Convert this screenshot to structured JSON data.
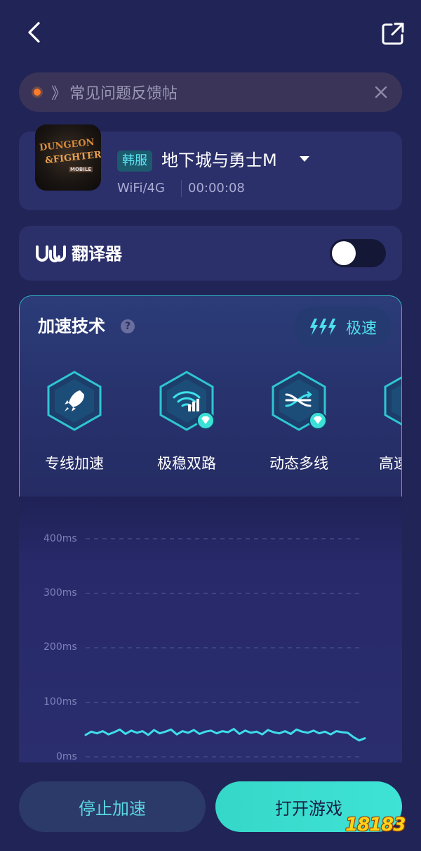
{
  "notice": {
    "arrow": "》",
    "text": "常见问题反馈帖"
  },
  "game": {
    "logo_line1": "DUNGEON",
    "logo_line2": "&FIGHTER",
    "logo_line3": "MOBILE",
    "region": "韩服",
    "title": "地下城与勇士M",
    "network": "WiFi/4G",
    "timer": "00:00:08"
  },
  "translator": {
    "label": "翻译器",
    "enabled": false
  },
  "tech": {
    "title": "加速技术",
    "help": "?",
    "speed_label": "极速",
    "features": [
      {
        "name": "专线加速",
        "icon": "rocket-icon",
        "premium": false
      },
      {
        "name": "极稳双路",
        "icon": "wifi-signal-icon",
        "premium": true
      },
      {
        "name": "动态多线",
        "icon": "multi-line-icon",
        "premium": true
      },
      {
        "name": "高速",
        "icon": "speed-icon",
        "premium": false
      }
    ]
  },
  "chart_data": {
    "type": "line",
    "title": "",
    "xlabel": "",
    "ylabel": "",
    "y_ticks": [
      "400ms",
      "300ms",
      "200ms",
      "100ms",
      "0ms"
    ],
    "ylim": [
      0,
      400
    ],
    "grid": true,
    "series": [
      {
        "values": [
          40,
          46,
          43,
          47,
          41,
          45,
          50,
          42,
          48,
          44,
          47,
          40,
          49,
          43,
          46,
          50,
          41,
          47,
          44,
          49,
          42,
          46,
          48,
          43,
          47,
          45,
          51,
          42,
          48,
          44,
          46,
          41,
          49,
          45,
          43,
          47,
          42,
          50,
          46,
          44,
          48,
          43,
          46,
          41,
          47,
          45,
          44,
          36,
          30,
          34
        ]
      }
    ],
    "color": "#3fdde8"
  },
  "buttons": {
    "stop": "停止加速",
    "open": "打开游戏"
  },
  "watermark": "18183",
  "colors": {
    "background": "#212456",
    "card": "#2b2f6a",
    "accent": "#36e0ea",
    "notice_dot": "#ff7a2a"
  }
}
